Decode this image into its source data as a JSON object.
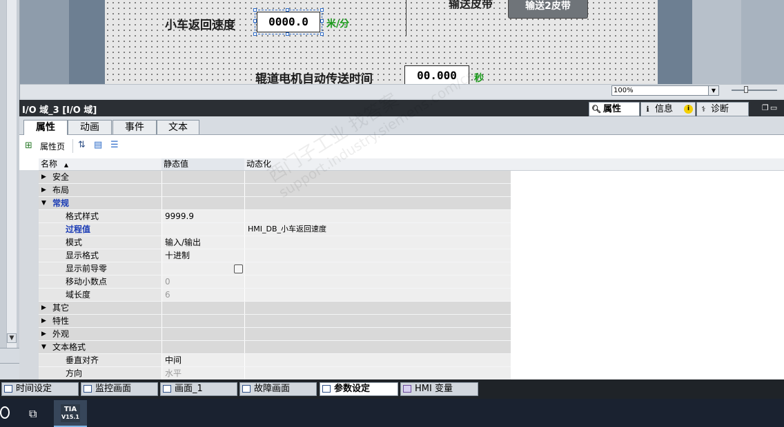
{
  "hmi_screen": {
    "top_text_partial": "输送皮带",
    "button_label": "输送2皮带",
    "cart_return_speed": {
      "label": "小车返回速度",
      "value": "0000.0",
      "unit": "米/分"
    },
    "roller_motor_time": {
      "label": "辊道电机自动传送时间",
      "value": "00.000",
      "unit": "秒"
    }
  },
  "zoom": {
    "value": "100%"
  },
  "inspector": {
    "title": "I/O 域_3 [I/O 域]",
    "top_tabs": [
      {
        "label": "属性",
        "icon": "properties-icon",
        "active": true
      },
      {
        "label": "信息",
        "icon": "info-icon",
        "active": false
      },
      {
        "label": "诊断",
        "icon": "diagnostics-icon",
        "active": false
      }
    ],
    "sub_tabs": [
      {
        "label": "属性",
        "active": true
      },
      {
        "label": "动画",
        "active": false
      },
      {
        "label": "事件",
        "active": false
      },
      {
        "label": "文本",
        "active": false
      }
    ],
    "toolbar": {
      "property_page_label": "属性页"
    },
    "columns": {
      "name": "名称",
      "static_value": "静态值",
      "dynamization": "动态化"
    },
    "rows": [
      {
        "type": "group",
        "label": "安全",
        "expanded": false
      },
      {
        "type": "group",
        "label": "布局",
        "expanded": false
      },
      {
        "type": "group",
        "label": "常规",
        "expanded": true,
        "highlight": true
      },
      {
        "type": "item",
        "label": "格式样式",
        "value": "9999.9"
      },
      {
        "type": "item",
        "label": "过程值",
        "value": "",
        "dyn": "HMI_DB_小车返回速度",
        "highlight": true
      },
      {
        "type": "item",
        "label": "模式",
        "value": "输入/输出"
      },
      {
        "type": "item",
        "label": "显示格式",
        "value": "十进制"
      },
      {
        "type": "item",
        "label": "显示前导零",
        "value": ""
      },
      {
        "type": "item",
        "label": "移动小数点",
        "value": "0",
        "disabled": true
      },
      {
        "type": "item",
        "label": "域长度",
        "value": "6",
        "disabled": true
      },
      {
        "type": "group",
        "label": "其它",
        "expanded": false
      },
      {
        "type": "group",
        "label": "特性",
        "expanded": false
      },
      {
        "type": "group",
        "label": "外观",
        "expanded": false
      },
      {
        "type": "group",
        "label": "文本格式",
        "expanded": true
      },
      {
        "type": "item",
        "label": "垂直对齐",
        "value": "中间"
      },
      {
        "type": "item",
        "label": "方向",
        "value": "水平",
        "disabled": true
      }
    ]
  },
  "watermark": {
    "line1": "西门子工业 找答案",
    "line2": "support.industry.siemens.com/cs"
  },
  "screen_tabs": [
    {
      "label": "时间设定",
      "active": false
    },
    {
      "label": "监控画面",
      "active": false
    },
    {
      "label": "画面_1",
      "active": false
    },
    {
      "label": "故障画面",
      "active": false
    },
    {
      "label": "参数设定",
      "active": true
    },
    {
      "label": "HMI 变量",
      "active": false,
      "icon": "hmi-tags-icon"
    }
  ],
  "taskbar": {
    "app_label_line1": "TIA",
    "app_label_line2": "V15.1"
  }
}
